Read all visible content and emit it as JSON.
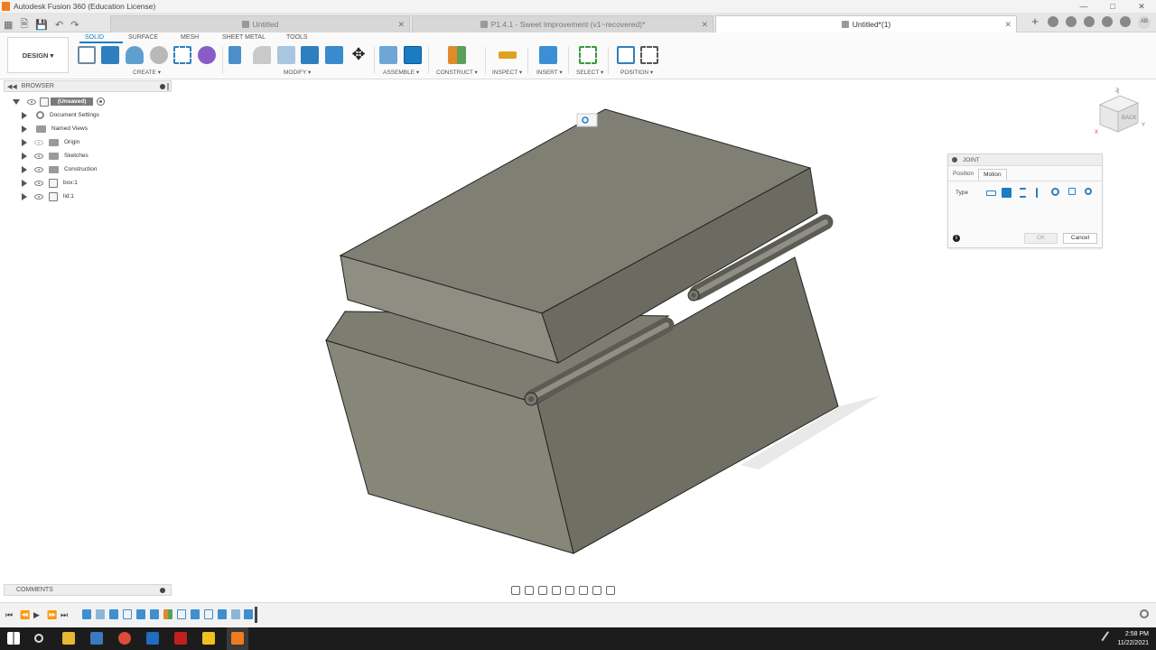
{
  "app": {
    "title": "Autodesk Fusion 360 (Education License)",
    "window_controls": [
      "—",
      "□",
      "✕"
    ]
  },
  "tabs": [
    {
      "label": "Untitled",
      "active": false
    },
    {
      "label": "P1.4.1 - Sweet Improvement (v1~recovered)*",
      "active": false
    },
    {
      "label": "Untitled*(1)",
      "active": true
    }
  ],
  "tab_close": "✕",
  "user_initials": "AB",
  "toolbar": {
    "workspace": "DESIGN ▾",
    "ribbon_tabs": [
      "SOLID",
      "SURFACE",
      "MESH",
      "SHEET METAL",
      "TOOLS"
    ],
    "groups": [
      "CREATE ▾",
      "MODIFY ▾",
      "ASSEMBLE ▾",
      "CONSTRUCT ▾",
      "INSPECT ▾",
      "INSERT ▾",
      "SELECT ▾",
      "POSITION ▾"
    ]
  },
  "browser": {
    "title": "BROWSER",
    "root": "(Unsaved)",
    "items": [
      {
        "label": "Document Settings",
        "icon": "gear-icon"
      },
      {
        "label": "Named Views",
        "icon": "folder-icon"
      },
      {
        "label": "Origin",
        "icon": "folder-icon"
      },
      {
        "label": "Sketches",
        "icon": "folder-icon"
      },
      {
        "label": "Construction",
        "icon": "folder-icon"
      },
      {
        "label": "box:1",
        "icon": "component-icon"
      },
      {
        "label": "lid:1",
        "icon": "component-icon"
      }
    ]
  },
  "joint": {
    "title": "JOINT",
    "tabs": [
      "Position",
      "Motion"
    ],
    "active_tab": "Motion",
    "type_label": "Type",
    "type_icons": [
      "rigid-joint-icon",
      "revolute-joint-icon",
      "slider-joint-icon",
      "cylindrical-joint-icon",
      "pin-slot-joint-icon",
      "planar-joint-icon",
      "ball-joint-icon"
    ],
    "selected_type_index": 1,
    "ok": "OK",
    "cancel": "Cancel"
  },
  "viewcube": {
    "face": "BACK",
    "axis_z": "Z",
    "axis_x": "X",
    "axis_y": "Y"
  },
  "comments": {
    "title": "COMMENTS"
  },
  "taskbar": {
    "time": "2:58 PM",
    "date": "11/22/2021"
  },
  "colors": {
    "accent": "#1a7cc4",
    "model": "#77776d"
  }
}
